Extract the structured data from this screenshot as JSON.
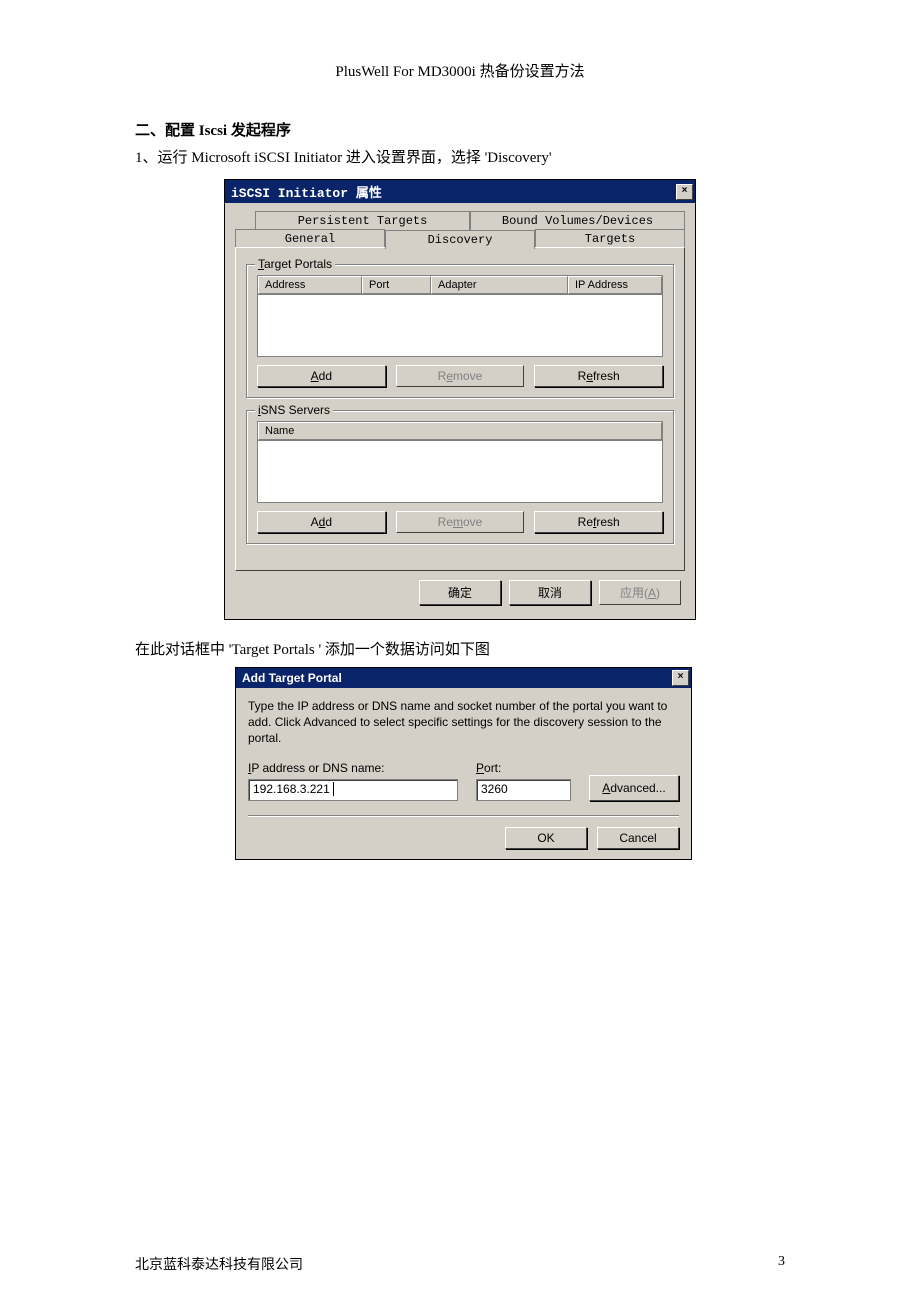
{
  "doc": {
    "header": "PlusWell For MD3000i  热备份设置方法",
    "section_title": "二、配置 Iscsi 发起程序",
    "step1": "1、运行 Microsoft iSCSI Initiator 进入设置界面，选择 'Discovery'",
    "mid_text": "在此对话框中   'Target Portals '  添加一个数据访问如下图",
    "footer_company": "北京蓝科泰达科技有限公司",
    "footer_page": "3"
  },
  "dialog1": {
    "title": "iSCSI Initiator 属性",
    "tabs_row1": {
      "persistent": "Persistent Targets",
      "bound": "Bound Volumes/Devices"
    },
    "tabs_row2": {
      "general": "General",
      "discovery": "Discovery",
      "targets": "Targets"
    },
    "group1": {
      "legend": "Target Portals",
      "legend_u": "T",
      "legend_rest": "arget Portals",
      "cols": {
        "address": "Address",
        "port": "Port",
        "adapter": "Adapter",
        "ip": "IP Address"
      },
      "add_u": "A",
      "add_rest": "dd",
      "remove_pre": "R",
      "remove_u": "e",
      "remove_rest": "move",
      "refresh_pre": "R",
      "refresh_u": "e",
      "refresh_rest": "fresh"
    },
    "group2": {
      "legend_u": "i",
      "legend_rest": "SNS Servers",
      "col_name": "Name",
      "add_pre": "A",
      "add_u": "d",
      "add_rest": "d",
      "remove_pre": "Re",
      "remove_u": "m",
      "remove_rest": "ove",
      "refresh_pre": "Re",
      "refresh_u": "f",
      "refresh_rest": "resh"
    },
    "buttons": {
      "ok": "确定",
      "cancel": "取消",
      "apply_pre": "应用(",
      "apply_u": "A",
      "apply_post": ")"
    }
  },
  "dialog2": {
    "title": "Add Target Portal",
    "desc": "Type the IP address or DNS name and socket number of the portal you want to add. Click Advanced to select specific settings for the discovery session to the portal.",
    "ip_label_u": "I",
    "ip_label_rest": "P address or DNS name:",
    "ip_value": "192.168.3.221",
    "port_label_u": "P",
    "port_label_rest": "ort:",
    "port_value": "3260",
    "advanced_u": "A",
    "advanced_rest": "dvanced...",
    "ok": "OK",
    "cancel": "Cancel"
  }
}
